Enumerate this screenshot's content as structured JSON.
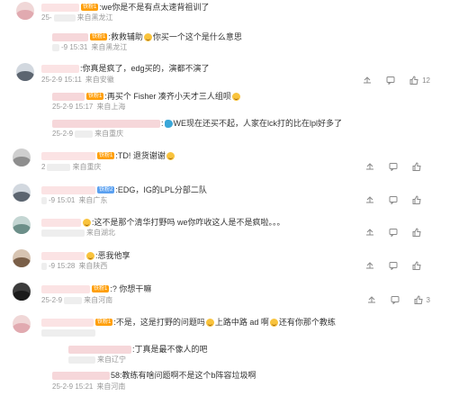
{
  "comments": [
    {
      "text": ":we你是不是有点太速背祖训了",
      "date": "25-",
      "location": "来自黑龙江",
      "like_count": "",
      "reply": {
        "text": ":救救辅助",
        "text2": "你买一个这个是什么意思",
        "date": "-9 15:31",
        "location": "来自黑龙江"
      }
    },
    {
      "text": ":你真是疯了，edg买的，演都不演了",
      "date": "25-2-9 15:11",
      "location": "来自安徽",
      "like_count": "12",
      "replies": [
        {
          "text": ":再买个 Fisher 凑齐小天才三人组呗",
          "date": "25-2-9 15:17",
          "location": "来自上海"
        },
        {
          "text": ":",
          "text2": "WE现在还买不起，人家在lck打的比在lpl好多了",
          "date": "25-2-9",
          "location": "来自重庆"
        }
      ]
    },
    {
      "text": ":TD!  退货谢谢",
      "date": "2",
      "location": "来自重庆",
      "like_count": ""
    },
    {
      "text": ":EDG，IG的LPL分部二队",
      "date": "-9 15:01",
      "location": "来自广东",
      "like_count": ""
    },
    {
      "text": ":这不是那个清华打野吗 we你咋收这人是不是疯啦。。。",
      "date": "",
      "location": "来自湖北",
      "like_count": ""
    },
    {
      "text": ":恶我他享",
      "date": "-9 15:28",
      "location": "来自陕西",
      "like_count": ""
    },
    {
      "text": ":?  你想干嘛",
      "date": "25-2-9",
      "location": "来自河南",
      "like_count": "3"
    },
    {
      "text": ":不是，这是打野的问题吗",
      "text2": "上路中路 ad 啊",
      "text3": "还有你那个教练",
      "date": "",
      "location": "",
      "like_count": "",
      "replies": [
        {
          "text": ":丁真是最不像人的吧",
          "date": "",
          "location": "来自辽宁"
        },
        {
          "text": "58:教练有啥问题啊不是这个b阵容垃圾啊",
          "date": "25-2-9 15:21",
          "location": "来自河南"
        }
      ]
    }
  ],
  "badges": {
    "fan": "铁粉1",
    "fan_level": "铁粉2"
  },
  "colors": {
    "text": "#333333",
    "meta": "#999999",
    "fan_badge": "#ff9f0a",
    "link_blue": "#5aa0f0"
  },
  "icons": [
    "share-icon",
    "comment-icon",
    "like-icon"
  ]
}
